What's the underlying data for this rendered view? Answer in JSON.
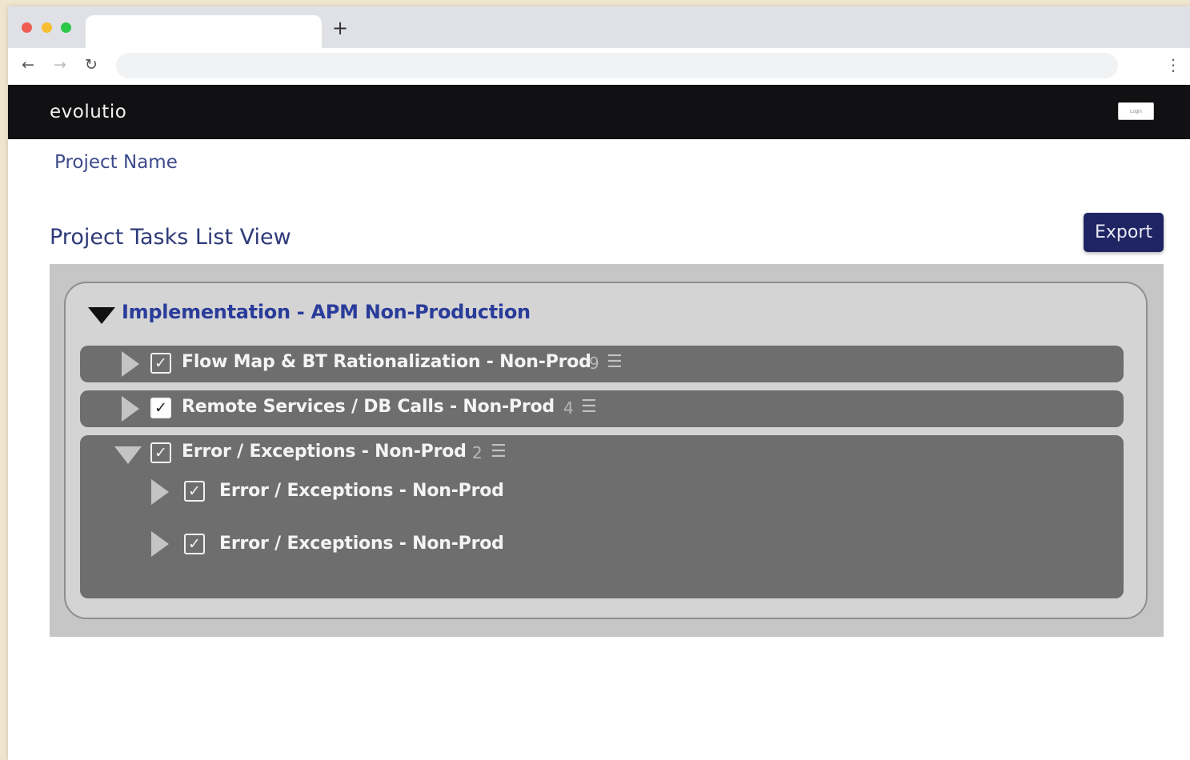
{
  "browser": {
    "tab_title": "",
    "new_tab": "+",
    "back": "←",
    "forward": "→",
    "reload": "↻",
    "url": "",
    "menu": "⋮",
    "traffic_lights": {
      "close": "#ee5c52",
      "minimize": "#f6be30",
      "maximize": "#2cc84a"
    }
  },
  "app": {
    "logo": "evolutio",
    "login_label": "Login"
  },
  "page": {
    "project_name": "Project Name",
    "view_title": "Project Tasks List View",
    "export_label": "Export"
  },
  "tasks": {
    "group_title": "Implementation - APM Non-Production",
    "group_expanded": true,
    "items": [
      {
        "label": "Flow Map & BT Rationalization - Non-Prod",
        "count": "9",
        "checked": true,
        "expanded": false
      },
      {
        "label": "Remote Services / DB Calls - Non-Prod",
        "count": "4",
        "checked": true,
        "expanded": false
      },
      {
        "label": "Error / Exceptions - Non-Prod",
        "count": "2",
        "checked": true,
        "expanded": true,
        "children": [
          {
            "label": "Error / Exceptions - Non-Prod",
            "checked": true
          },
          {
            "label": "Error / Exceptions - Non-Prod",
            "checked": true
          }
        ]
      }
    ]
  },
  "icons": {
    "check": "✓",
    "list": "☰"
  },
  "colors": {
    "header_bg": "#111113",
    "accent_blue": "#2a3c9a",
    "export_bg": "#1f2463",
    "row_bg": "#6e6e6e",
    "panel_bg": "#c6c6c6"
  }
}
